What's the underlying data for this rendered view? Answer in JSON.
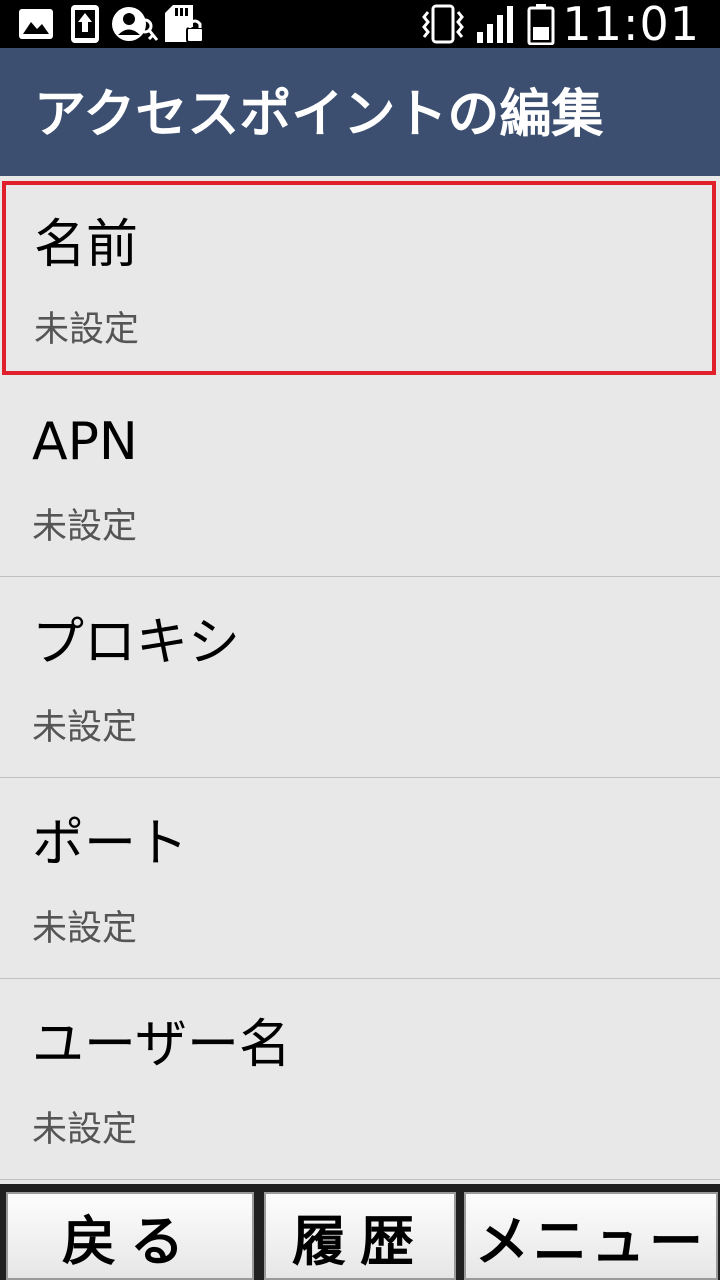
{
  "status_bar": {
    "time": "11:01",
    "icons": [
      "image-icon",
      "upload-icon",
      "account-key-icon",
      "sd-card-lock-icon",
      "vibrate-icon",
      "signal-icon",
      "battery-icon"
    ]
  },
  "header": {
    "title": "アクセスポイントの編集"
  },
  "list": {
    "items": [
      {
        "label": "名前",
        "value": "未設定"
      },
      {
        "label": "APN",
        "value": "未設定"
      },
      {
        "label": "プロキシ",
        "value": "未設定"
      },
      {
        "label": "ポート",
        "value": "未設定"
      },
      {
        "label": "ユーザー名",
        "value": "未設定"
      }
    ],
    "selected_index": 0
  },
  "softkeys": {
    "back": "戻る",
    "history": "履歴",
    "menu": "メニュー"
  },
  "colors": {
    "header_bg": "#3c4f70",
    "list_bg": "#e8e8e8",
    "selection_border": "#e0202a"
  }
}
